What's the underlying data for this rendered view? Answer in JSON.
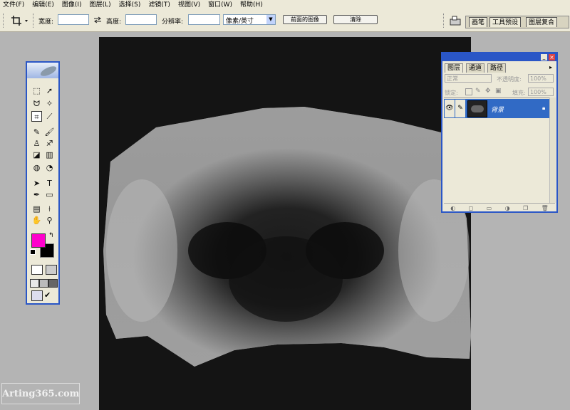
{
  "menu": [
    "文件(F)",
    "编辑(E)",
    "图像(I)",
    "图层(L)",
    "选择(S)",
    "滤镜(T)",
    "视图(V)",
    "窗口(W)",
    "帮助(H)"
  ],
  "options": {
    "width_label": "宽度:",
    "height_label": "高度:",
    "swap_icon": "swap-arrows-icon",
    "resolution_label": "分辨率:",
    "unit_select": "像素/英寸",
    "front_image_button": "前面的图像",
    "clear_button": "清除",
    "palette_tabs": [
      "画笔",
      "工具预设",
      "图层复合"
    ]
  },
  "colors": {
    "foreground": "#ff00cc",
    "background": "#000000",
    "accent": "#2a56c6"
  },
  "layers_panel": {
    "tabs": [
      "图层",
      "通道",
      "路径"
    ],
    "blend_mode": "正常",
    "opacity_label": "不透明度:",
    "opacity_value": "100%",
    "lock_label": "锁定:",
    "fill_label": "填充:",
    "fill_value": "100%",
    "layer_name": "背景"
  },
  "watermark": "Arting365.com"
}
